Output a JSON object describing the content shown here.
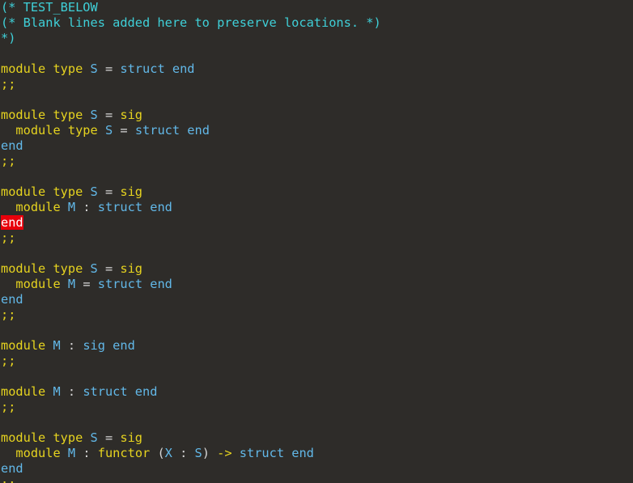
{
  "editor": {
    "language": "ocaml",
    "colors": {
      "background": "#2e2c29",
      "comment": "#3fd0d8",
      "keyword": "#e6d31f",
      "module_name": "#62b8e8",
      "operator": "#d6d6d6",
      "error_background": "#e8000b",
      "error_text": "#ffffff"
    },
    "lines": [
      {
        "n": 1,
        "tokens": [
          {
            "t": "(* TEST_BELOW",
            "c": "comment"
          }
        ]
      },
      {
        "n": 2,
        "tokens": [
          {
            "t": "(* Blank lines added here to preserve locations. *)",
            "c": "comment"
          }
        ]
      },
      {
        "n": 3,
        "tokens": [
          {
            "t": "*)",
            "c": "comment"
          }
        ]
      },
      {
        "n": 4,
        "tokens": []
      },
      {
        "n": 5,
        "tokens": [
          {
            "t": "module type",
            "c": "kw"
          },
          {
            "t": " ",
            "c": "op"
          },
          {
            "t": "S",
            "c": "mod"
          },
          {
            "t": " = ",
            "c": "op"
          },
          {
            "t": "struct end",
            "c": "mod"
          }
        ]
      },
      {
        "n": 6,
        "tokens": [
          {
            "t": ";;",
            "c": "kw"
          }
        ]
      },
      {
        "n": 7,
        "tokens": []
      },
      {
        "n": 8,
        "tokens": [
          {
            "t": "module type",
            "c": "kw"
          },
          {
            "t": " ",
            "c": "op"
          },
          {
            "t": "S",
            "c": "mod"
          },
          {
            "t": " = ",
            "c": "op"
          },
          {
            "t": "sig",
            "c": "kw"
          }
        ]
      },
      {
        "n": 9,
        "tokens": [
          {
            "t": "  module type",
            "c": "kw"
          },
          {
            "t": " ",
            "c": "op"
          },
          {
            "t": "S",
            "c": "mod"
          },
          {
            "t": " = ",
            "c": "op"
          },
          {
            "t": "struct end",
            "c": "mod"
          }
        ]
      },
      {
        "n": 10,
        "tokens": [
          {
            "t": "end",
            "c": "mod"
          }
        ]
      },
      {
        "n": 11,
        "tokens": [
          {
            "t": ";;",
            "c": "kw"
          }
        ]
      },
      {
        "n": 12,
        "tokens": []
      },
      {
        "n": 13,
        "tokens": [
          {
            "t": "module type",
            "c": "kw"
          },
          {
            "t": " ",
            "c": "op"
          },
          {
            "t": "S",
            "c": "mod"
          },
          {
            "t": " = ",
            "c": "op"
          },
          {
            "t": "sig",
            "c": "kw"
          }
        ]
      },
      {
        "n": 14,
        "tokens": [
          {
            "t": "  module",
            "c": "kw"
          },
          {
            "t": " ",
            "c": "op"
          },
          {
            "t": "M",
            "c": "mod"
          },
          {
            "t": " : ",
            "c": "op"
          },
          {
            "t": "struct end",
            "c": "mod"
          }
        ]
      },
      {
        "n": 15,
        "tokens": [
          {
            "t": "end",
            "c": "err"
          }
        ]
      },
      {
        "n": 16,
        "tokens": [
          {
            "t": ";;",
            "c": "kw"
          }
        ]
      },
      {
        "n": 17,
        "tokens": []
      },
      {
        "n": 18,
        "tokens": [
          {
            "t": "module type",
            "c": "kw"
          },
          {
            "t": " ",
            "c": "op"
          },
          {
            "t": "S",
            "c": "mod"
          },
          {
            "t": " = ",
            "c": "op"
          },
          {
            "t": "sig",
            "c": "kw"
          }
        ]
      },
      {
        "n": 19,
        "tokens": [
          {
            "t": "  module",
            "c": "kw"
          },
          {
            "t": " ",
            "c": "op"
          },
          {
            "t": "M",
            "c": "mod"
          },
          {
            "t": " = ",
            "c": "op"
          },
          {
            "t": "struct end",
            "c": "mod"
          }
        ]
      },
      {
        "n": 20,
        "tokens": [
          {
            "t": "end",
            "c": "mod"
          }
        ]
      },
      {
        "n": 21,
        "tokens": [
          {
            "t": ";;",
            "c": "kw"
          }
        ]
      },
      {
        "n": 22,
        "tokens": []
      },
      {
        "n": 23,
        "tokens": [
          {
            "t": "module",
            "c": "kw"
          },
          {
            "t": " ",
            "c": "op"
          },
          {
            "t": "M",
            "c": "mod"
          },
          {
            "t": " : ",
            "c": "op"
          },
          {
            "t": "sig end",
            "c": "mod"
          }
        ]
      },
      {
        "n": 24,
        "tokens": [
          {
            "t": ";;",
            "c": "kw"
          }
        ]
      },
      {
        "n": 25,
        "tokens": []
      },
      {
        "n": 26,
        "tokens": [
          {
            "t": "module",
            "c": "kw"
          },
          {
            "t": " ",
            "c": "op"
          },
          {
            "t": "M",
            "c": "mod"
          },
          {
            "t": " : ",
            "c": "op"
          },
          {
            "t": "struct end",
            "c": "mod"
          }
        ]
      },
      {
        "n": 27,
        "tokens": [
          {
            "t": ";;",
            "c": "kw"
          }
        ]
      },
      {
        "n": 28,
        "tokens": []
      },
      {
        "n": 29,
        "tokens": [
          {
            "t": "module type",
            "c": "kw"
          },
          {
            "t": " ",
            "c": "op"
          },
          {
            "t": "S",
            "c": "mod"
          },
          {
            "t": " = ",
            "c": "op"
          },
          {
            "t": "sig",
            "c": "kw"
          }
        ]
      },
      {
        "n": 30,
        "tokens": [
          {
            "t": "  module",
            "c": "kw"
          },
          {
            "t": " ",
            "c": "op"
          },
          {
            "t": "M",
            "c": "mod"
          },
          {
            "t": " : ",
            "c": "op"
          },
          {
            "t": "functor",
            "c": "kw"
          },
          {
            "t": " (",
            "c": "op"
          },
          {
            "t": "X",
            "c": "mod"
          },
          {
            "t": " : ",
            "c": "op"
          },
          {
            "t": "S",
            "c": "mod"
          },
          {
            "t": ") ",
            "c": "op"
          },
          {
            "t": "->",
            "c": "arrow"
          },
          {
            "t": " ",
            "c": "op"
          },
          {
            "t": "struct end",
            "c": "mod"
          }
        ]
      },
      {
        "n": 31,
        "tokens": [
          {
            "t": "end",
            "c": "mod"
          }
        ]
      },
      {
        "n": 32,
        "tokens": [
          {
            "t": ";;",
            "c": "kw"
          }
        ]
      }
    ]
  }
}
